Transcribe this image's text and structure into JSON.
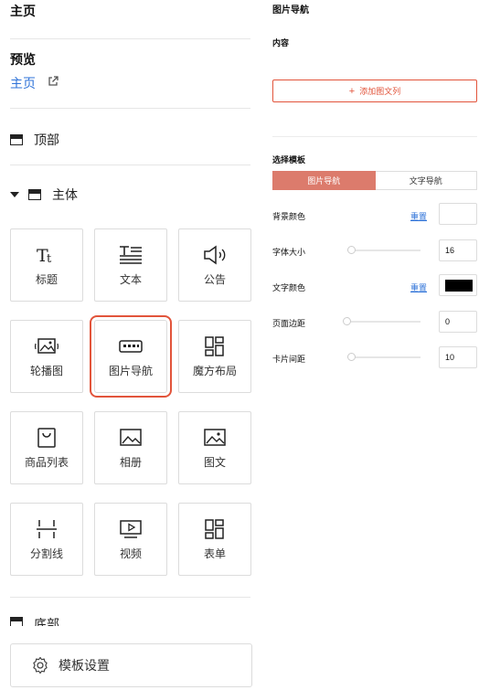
{
  "left": {
    "home_title": "主页",
    "preview_title": "预览",
    "preview_link": "主页",
    "top_section": "顶部",
    "body_section": "主体",
    "footer_section": "底部",
    "components": [
      {
        "label": "标题",
        "icon": "title-icon"
      },
      {
        "label": "文本",
        "icon": "text-icon"
      },
      {
        "label": "公告",
        "icon": "announcement-icon"
      },
      {
        "label": "轮播图",
        "icon": "carousel-icon"
      },
      {
        "label": "图片导航",
        "icon": "image-nav-icon",
        "selected": true
      },
      {
        "label": "魔方布局",
        "icon": "cube-layout-icon"
      },
      {
        "label": "商品列表",
        "icon": "product-list-icon"
      },
      {
        "label": "相册",
        "icon": "album-icon"
      },
      {
        "label": "图文",
        "icon": "image-text-icon"
      },
      {
        "label": "分割线",
        "icon": "divider-icon"
      },
      {
        "label": "视频",
        "icon": "video-icon"
      },
      {
        "label": "表单",
        "icon": "form-icon"
      }
    ],
    "template_settings": "模板设置"
  },
  "right": {
    "title": "图片导航",
    "content_label": "内容",
    "add_button": "添加图文列",
    "template_label": "选择模板",
    "template_options": [
      "图片导航",
      "文字导航"
    ],
    "selected_template": "图片导航",
    "bg_color_label": "背景颜色",
    "reset_label": "重置",
    "font_size_label": "字体大小",
    "font_size_value": "16",
    "text_color_label": "文字颜色",
    "text_color": "#000000",
    "page_margin_label": "页面边距",
    "page_margin_value": "0",
    "card_spacing_label": "卡片间距",
    "card_spacing_value": "10"
  },
  "colors": {
    "accent": "#e2543b",
    "segment_active": "#dc7b6c",
    "link": "#2f73d8"
  }
}
